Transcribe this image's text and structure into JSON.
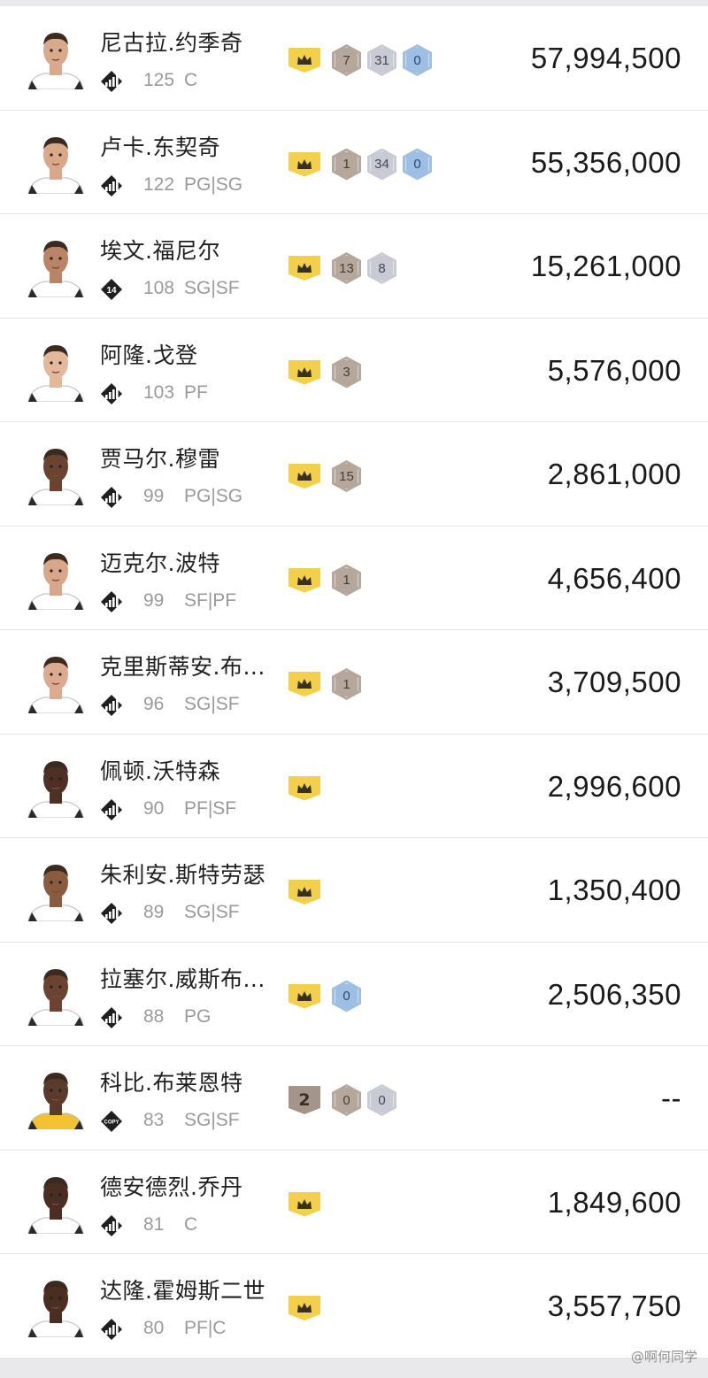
{
  "players": [
    {
      "name": "尼古拉.约季奇",
      "ovr": "125",
      "pos": "C",
      "value": "57,994,500",
      "tier": "stat-icon",
      "jersey": "#ffffff",
      "badges": [
        {
          "type": "crown"
        },
        {
          "type": "hex",
          "tone": "bronze",
          "text": "7"
        },
        {
          "type": "hex",
          "tone": "silver",
          "text": "31"
        },
        {
          "type": "hex",
          "tone": "blue",
          "text": "0"
        }
      ]
    },
    {
      "name": "卢卡.东契奇",
      "ovr": "122",
      "pos": "PG|SG",
      "value": "55,356,000",
      "tier": "stat-icon",
      "jersey": "#ffffff",
      "badges": [
        {
          "type": "crown"
        },
        {
          "type": "hex",
          "tone": "bronze",
          "text": "1"
        },
        {
          "type": "hex",
          "tone": "silver",
          "text": "34"
        },
        {
          "type": "hex",
          "tone": "blue",
          "text": "0"
        }
      ]
    },
    {
      "name": "埃文.福尼尔",
      "ovr": "108",
      "pos": "SG|SF",
      "value": "15,261,000",
      "tier": "number-icon",
      "tier_text": "14",
      "jersey": "#ffffff",
      "badges": [
        {
          "type": "crown"
        },
        {
          "type": "hex",
          "tone": "bronze",
          "text": "13"
        },
        {
          "type": "hex",
          "tone": "silver",
          "text": "8"
        }
      ]
    },
    {
      "name": "阿隆.戈登",
      "ovr": "103",
      "pos": "PF",
      "value": "5,576,000",
      "tier": "stat-icon",
      "jersey": "#ffffff",
      "badges": [
        {
          "type": "crown"
        },
        {
          "type": "hex",
          "tone": "bronze",
          "text": "3"
        }
      ]
    },
    {
      "name": "贾马尔.穆雷",
      "ovr": "99",
      "pos": "PG|SG",
      "value": "2,861,000",
      "tier": "stat-icon",
      "jersey": "#ffffff",
      "badges": [
        {
          "type": "crown"
        },
        {
          "type": "hex",
          "tone": "bronze",
          "text": "15"
        }
      ]
    },
    {
      "name": "迈克尔.波特",
      "ovr": "99",
      "pos": "SF|PF",
      "value": "4,656,400",
      "tier": "stat-icon",
      "jersey": "#ffffff",
      "badges": [
        {
          "type": "crown"
        },
        {
          "type": "hex",
          "tone": "bronze",
          "text": "1"
        }
      ]
    },
    {
      "name": "克里斯蒂安.布...",
      "ovr": "96",
      "pos": "SG|SF",
      "value": "3,709,500",
      "tier": "stat-icon",
      "jersey": "#ffffff",
      "badges": [
        {
          "type": "crown"
        },
        {
          "type": "hex",
          "tone": "bronze",
          "text": "1"
        }
      ]
    },
    {
      "name": "佩顿.沃特森",
      "ovr": "90",
      "pos": "PF|SF",
      "value": "2,996,600",
      "tier": "stat-icon",
      "jersey": "#ffffff",
      "badges": [
        {
          "type": "crown"
        }
      ]
    },
    {
      "name": "朱利安.斯特劳瑟",
      "ovr": "89",
      "pos": "SG|SF",
      "value": "1,350,400",
      "tier": "stat-icon",
      "jersey": "#ffffff",
      "badges": [
        {
          "type": "crown"
        }
      ]
    },
    {
      "name": "拉塞尔.威斯布...",
      "ovr": "88",
      "pos": "PG",
      "value": "2,506,350",
      "tier": "stat-icon",
      "jersey": "#ffffff",
      "badges": [
        {
          "type": "crown"
        },
        {
          "type": "hex",
          "tone": "blue",
          "text": "0"
        }
      ]
    },
    {
      "name": "科比.布莱恩特",
      "ovr": "83",
      "pos": "SG|SF",
      "value": "--",
      "tier": "copy-icon",
      "tier_text": "COPY",
      "jersey": "#f2c230",
      "badges": [
        {
          "type": "level",
          "text": "2"
        },
        {
          "type": "hex",
          "tone": "bronze",
          "text": "0"
        },
        {
          "type": "hex",
          "tone": "silver",
          "text": "0"
        }
      ]
    },
    {
      "name": "德安德烈.乔丹",
      "ovr": "81",
      "pos": "C",
      "value": "1,849,600",
      "tier": "stat-icon",
      "jersey": "#ffffff",
      "badges": [
        {
          "type": "crown"
        }
      ]
    },
    {
      "name": "达隆.霍姆斯二世",
      "ovr": "80",
      "pos": "PF|C",
      "value": "3,557,750",
      "tier": "stat-icon",
      "jersey": "#ffffff",
      "badges": [
        {
          "type": "crown"
        }
      ]
    }
  ],
  "watermark": "@啊何同学",
  "colors": {
    "crown": "#f3d04b",
    "bronze": "#b5a79b",
    "silver": "#c8cad4",
    "blue": "#9ebfe3",
    "text_muted": "#9a9a9a"
  }
}
